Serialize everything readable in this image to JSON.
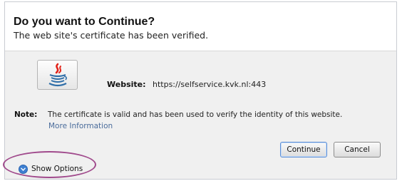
{
  "dialog": {
    "title": "Do you want to Continue?",
    "subtitle": "The web site's certificate has been verified.",
    "icon": "java-icon",
    "website_label": "Website:",
    "website_value": "https://selfservice.kvk.nl:443",
    "note_label": "Note:",
    "note_text": "The certificate is valid and has been used to verify the identity of this website.",
    "more_info_link": "More Information",
    "buttons": {
      "continue": "Continue",
      "cancel": "Cancel"
    },
    "show_options": {
      "label": "Show Options",
      "icon": "chevron-down-icon"
    }
  },
  "colors": {
    "link": "#4a6c9b",
    "highlight_ring": "#a04a8c",
    "options_icon": "#3d7fd1"
  }
}
